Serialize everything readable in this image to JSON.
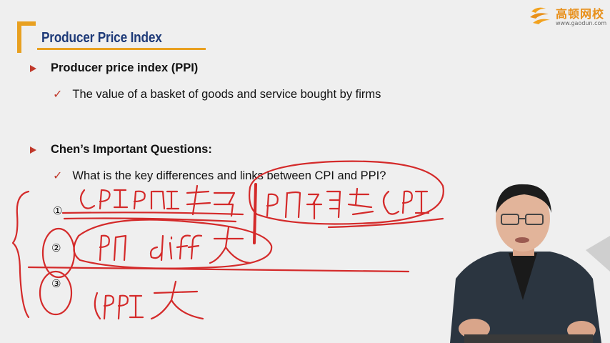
{
  "slide": {
    "title": "Producer Price Index",
    "bullets": [
      {
        "label": "Producer price index (PPI)",
        "sub": "The value of a basket of goods and service bought by firms"
      },
      {
        "label": "Chen’s Important Questions:",
        "sub": "What is the key differences and links between CPI and PPI?"
      }
    ]
  },
  "logo": {
    "name": "高顿网校",
    "url": "www.gaodun.com",
    "icon": "gaodun-logo-icon"
  },
  "colors": {
    "title": "#1e3a78",
    "accent_orange": "#e8a020",
    "marker_red": "#c0392b",
    "ink_red": "#d42a2a",
    "background": "#efefef"
  },
  "annotations": {
    "circled_numbers": [
      "①",
      "②",
      "③"
    ]
  }
}
